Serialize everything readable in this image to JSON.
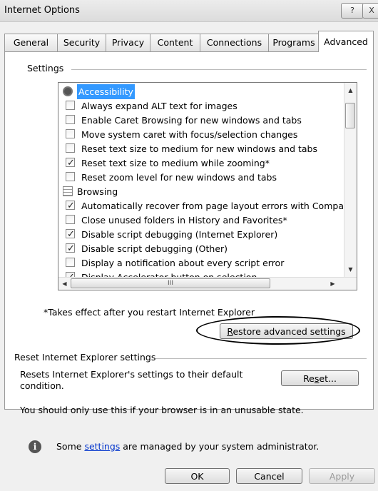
{
  "window": {
    "title": "Internet Options",
    "help_glyph": "?",
    "close_glyph": "X"
  },
  "tabs": [
    {
      "label": "General"
    },
    {
      "label": "Security"
    },
    {
      "label": "Privacy"
    },
    {
      "label": "Content"
    },
    {
      "label": "Connections"
    },
    {
      "label": "Programs"
    },
    {
      "label": "Advanced"
    }
  ],
  "settings": {
    "group_label": "Settings",
    "items": [
      {
        "type": "category",
        "label": "Accessibility",
        "icon": "accessibility-icon",
        "selected": true
      },
      {
        "type": "option",
        "label": "Always expand ALT text for images",
        "checked": false
      },
      {
        "type": "option",
        "label": "Enable Caret Browsing for new windows and tabs",
        "checked": false
      },
      {
        "type": "option",
        "label": "Move system caret with focus/selection changes",
        "checked": false
      },
      {
        "type": "option",
        "label": "Reset text size to medium for new windows and tabs",
        "checked": false
      },
      {
        "type": "option",
        "label": "Reset text size to medium while zooming*",
        "checked": true
      },
      {
        "type": "option",
        "label": "Reset zoom level for new windows and tabs",
        "checked": false
      },
      {
        "type": "category",
        "label": "Browsing",
        "icon": "browsing-folder-icon",
        "selected": false
      },
      {
        "type": "option",
        "label": "Automatically recover from page layout errors with Compa",
        "checked": true
      },
      {
        "type": "option",
        "label": "Close unused folders in History and Favorites*",
        "checked": false
      },
      {
        "type": "option",
        "label": "Disable script debugging (Internet Explorer)",
        "checked": true
      },
      {
        "type": "option",
        "label": "Disable script debugging (Other)",
        "checked": true
      },
      {
        "type": "option",
        "label": "Display a notification about every script error",
        "checked": false
      },
      {
        "type": "option",
        "label": "Display Accelerator button on selection",
        "checked": true
      }
    ],
    "footnote": "*Takes effect after you restart Internet Explorer",
    "restore_button": {
      "prefix": "",
      "mnemonic": "R",
      "suffix": "estore advanced settings"
    }
  },
  "reset_group": {
    "label": "Reset Internet Explorer settings",
    "description_line1": "Resets Internet Explorer's settings to their default",
    "description_line2": "condition.",
    "reset_button": {
      "prefix": "Re",
      "mnemonic": "s",
      "suffix": "et..."
    },
    "warning": "You should only use this if your browser is in an unusable state."
  },
  "admin_notice": {
    "prefix": "Some ",
    "link": "settings",
    "suffix": " are managed by your system administrator."
  },
  "footer_buttons": {
    "ok": "OK",
    "cancel": "Cancel",
    "apply": "Apply",
    "apply_enabled": false
  },
  "scrollbar_glyphs": {
    "up": "▲",
    "down": "▼",
    "left": "◀",
    "right": "▶",
    "thumb_grip": "III"
  },
  "colors": {
    "selection": "#3399ff",
    "window_bg": "#f0f0f0"
  }
}
